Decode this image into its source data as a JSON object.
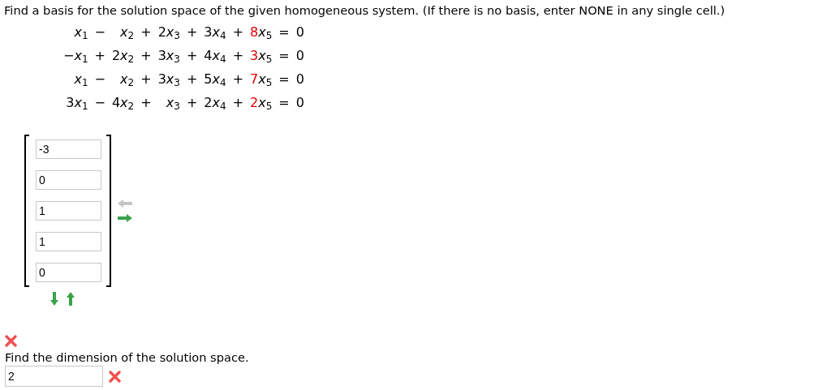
{
  "prompt": "Find a basis for the solution space of the given homogeneous system. (If there is no basis, enter NONE in any single cell.)",
  "equations": [
    {
      "cells": [
        {
          "kind": "term",
          "var": "x$_{1}$"
        },
        {
          "kind": "op",
          "text": "−"
        },
        {
          "kind": "term",
          "var": "x$_{2}$"
        },
        {
          "kind": "op",
          "text": "+"
        },
        {
          "kind": "term",
          "coef": "2",
          "var": "x$_{3}$"
        },
        {
          "kind": "op",
          "text": "+"
        },
        {
          "kind": "term",
          "coef": "3",
          "var": "x$_{4}$"
        },
        {
          "kind": "op",
          "text": "+"
        },
        {
          "kind": "term",
          "coef": "8",
          "var": "x$_{5}$",
          "highlight": true
        },
        {
          "kind": "op",
          "text": "="
        },
        {
          "kind": "term",
          "coef": "0"
        }
      ]
    },
    {
      "cells": [
        {
          "kind": "term",
          "coef": "−",
          "var": "x$_{1}$"
        },
        {
          "kind": "op",
          "text": "+"
        },
        {
          "kind": "term",
          "coef": "2",
          "var": "x$_{2}$"
        },
        {
          "kind": "op",
          "text": "+"
        },
        {
          "kind": "term",
          "coef": "3",
          "var": "x$_{3}$"
        },
        {
          "kind": "op",
          "text": "+"
        },
        {
          "kind": "term",
          "coef": "4",
          "var": "x$_{4}$"
        },
        {
          "kind": "op",
          "text": "+"
        },
        {
          "kind": "term",
          "coef": "3",
          "var": "x$_{5}$",
          "highlight": true
        },
        {
          "kind": "op",
          "text": "="
        },
        {
          "kind": "term",
          "coef": "0"
        }
      ]
    },
    {
      "cells": [
        {
          "kind": "term",
          "var": "x$_{1}$"
        },
        {
          "kind": "op",
          "text": "−"
        },
        {
          "kind": "term",
          "var": "x$_{2}$"
        },
        {
          "kind": "op",
          "text": "+"
        },
        {
          "kind": "term",
          "coef": "3",
          "var": "x$_{3}$"
        },
        {
          "kind": "op",
          "text": "+"
        },
        {
          "kind": "term",
          "coef": "5",
          "var": "x$_{4}$"
        },
        {
          "kind": "op",
          "text": "+"
        },
        {
          "kind": "term",
          "coef": "7",
          "var": "x$_{5}$",
          "highlight": true
        },
        {
          "kind": "op",
          "text": "="
        },
        {
          "kind": "term",
          "coef": "0"
        }
      ]
    },
    {
      "cells": [
        {
          "kind": "term",
          "coef": "3",
          "var": "x$_{1}$"
        },
        {
          "kind": "op",
          "text": "−"
        },
        {
          "kind": "term",
          "coef": "4",
          "var": "x$_{2}$"
        },
        {
          "kind": "op",
          "text": "+"
        },
        {
          "kind": "term",
          "var": "x$_{3}$"
        },
        {
          "kind": "op",
          "text": "+"
        },
        {
          "kind": "term",
          "coef": "2",
          "var": "x$_{4}$"
        },
        {
          "kind": "op",
          "text": "+"
        },
        {
          "kind": "term",
          "coef": "2",
          "var": "x$_{5}$",
          "highlight": true
        },
        {
          "kind": "op",
          "text": "="
        },
        {
          "kind": "term",
          "coef": "0"
        }
      ]
    }
  ],
  "basis_vector": {
    "entries": [
      "-3",
      "0",
      "1",
      "1",
      "0"
    ]
  },
  "vector_controls": {
    "remove_enabled": false,
    "add_enabled": true,
    "row_down_enabled": true,
    "row_up_enabled": true
  },
  "basis_result": {
    "correct": false
  },
  "dimension": {
    "prompt": "Find the dimension of the solution space.",
    "value": "2",
    "correct": false
  }
}
